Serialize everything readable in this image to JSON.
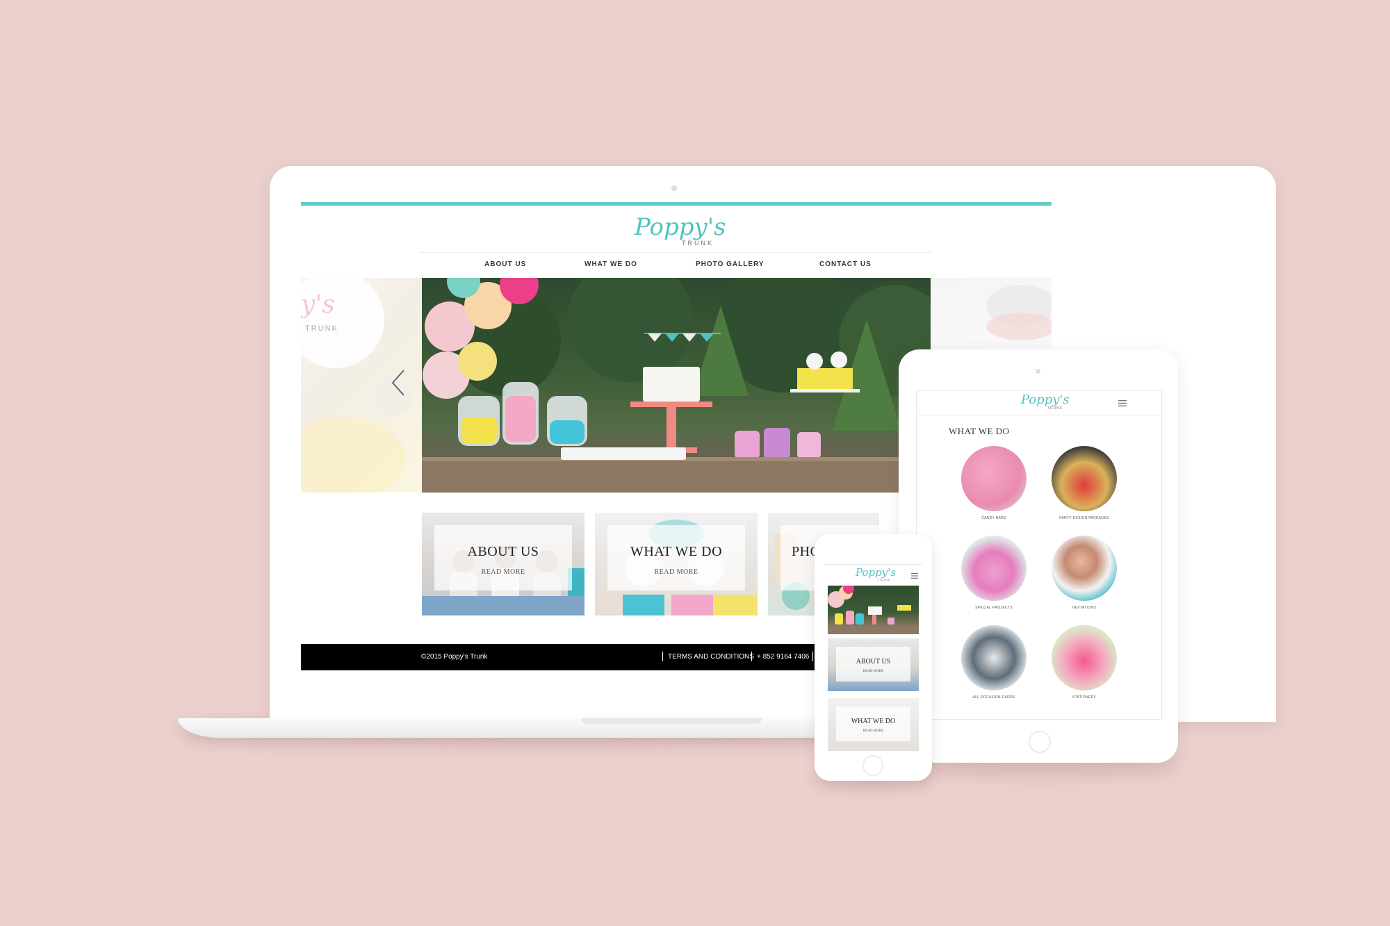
{
  "brand": {
    "logo_script": "Poppy's",
    "logo_sub": "TRUNK"
  },
  "desktop": {
    "nav": [
      "ABOUT US",
      "WHAT WE DO",
      "PHOTO GALLERY",
      "CONTACT US"
    ],
    "cards": [
      {
        "title": "ABOUT US",
        "more": "READ MORE"
      },
      {
        "title": "WHAT WE DO",
        "more": "READ MORE"
      },
      {
        "title": "PHO",
        "more": ""
      }
    ],
    "footer": {
      "copyright": "©2015 Poppy's Trunk",
      "terms": "TERMS AND CONDITIONS",
      "phone": "+ 852 9164 7406"
    }
  },
  "tablet": {
    "section_title": "WHAT WE DO",
    "items": [
      "CANDY BARS",
      "PARTY DESIGN PACKAGES",
      "SPECIAL PROJECTS",
      "INVITATIONS",
      "ALL OCCASION CARDS",
      "STATIONERY"
    ]
  },
  "phone": {
    "cards": [
      {
        "title": "ABOUT US",
        "more": "READ MORE"
      },
      {
        "title": "WHAT WE DO",
        "more": "READ MORE"
      }
    ]
  },
  "colors": {
    "background": "#ebd0cd",
    "accent": "#5ecbcb",
    "footer": "#000000"
  }
}
